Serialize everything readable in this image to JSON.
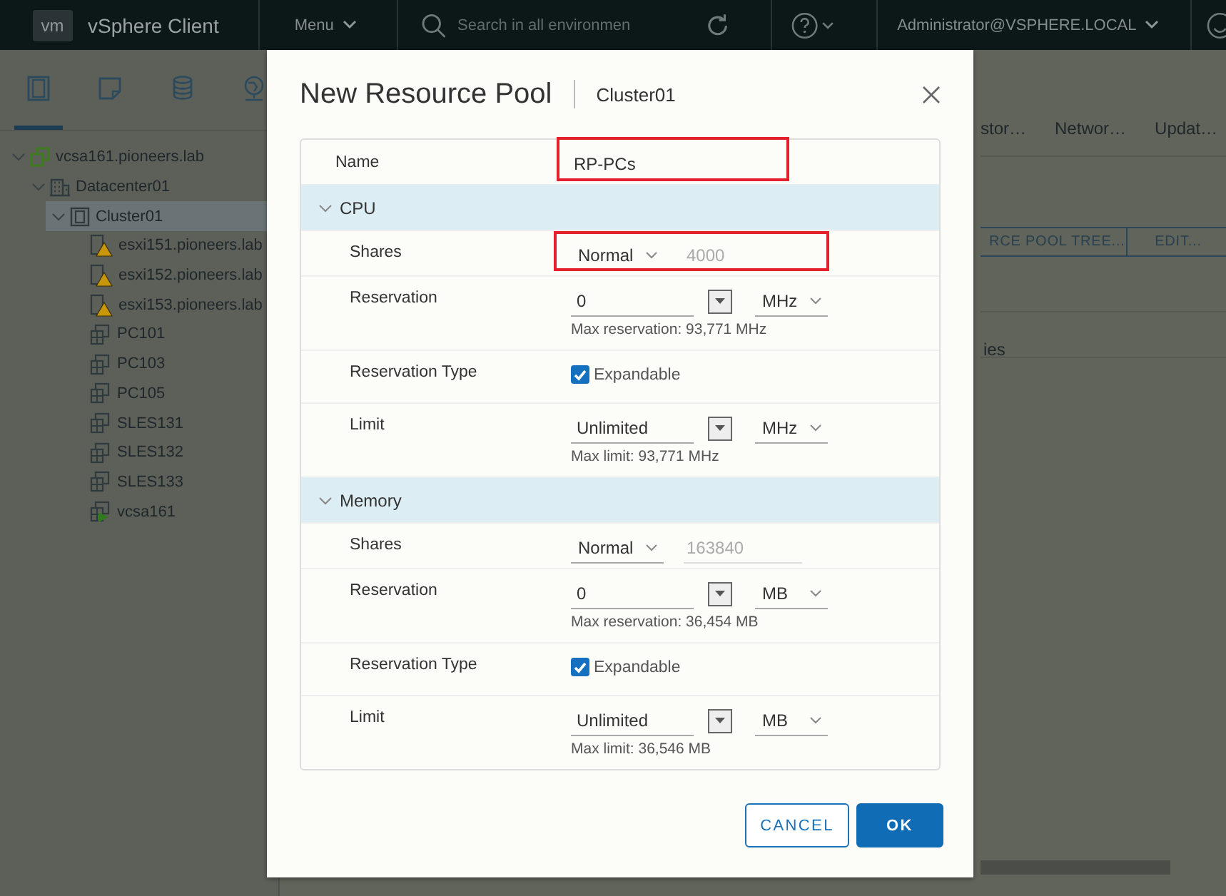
{
  "header": {
    "logo": "vm",
    "title": "vSphere Client",
    "menu": "Menu",
    "search_placeholder": "Search in all environmen",
    "user": "Administrator@VSPHERE.LOCAL"
  },
  "sidebar": {
    "tabs": [
      {
        "kind": "hosts",
        "selected": true
      },
      {
        "kind": "vms",
        "selected": false
      },
      {
        "kind": "storage",
        "selected": false
      },
      {
        "kind": "network",
        "selected": false
      }
    ],
    "tree": [
      {
        "label": "vcsa161.pioneers.lab",
        "kind": "vcenter",
        "expanded": true,
        "selected": false,
        "children": [
          {
            "label": "Datacenter01",
            "kind": "datacenter",
            "expanded": true,
            "selected": false,
            "children": [
              {
                "label": "Cluster01",
                "kind": "cluster",
                "expanded": true,
                "selected": true,
                "children": [
                  {
                    "label": "esxi151.pioneers.lab",
                    "kind": "host",
                    "warning": true,
                    "selected": false
                  },
                  {
                    "label": "esxi152.pioneers.lab",
                    "kind": "host",
                    "warning": true,
                    "selected": false
                  },
                  {
                    "label": "esxi153.pioneers.lab",
                    "kind": "host",
                    "warning": true,
                    "selected": false
                  },
                  {
                    "label": "PC101",
                    "kind": "vm",
                    "selected": false
                  },
                  {
                    "label": "PC103",
                    "kind": "vm",
                    "selected": false
                  },
                  {
                    "label": "PC105",
                    "kind": "vm",
                    "selected": false
                  },
                  {
                    "label": "SLES131",
                    "kind": "vm",
                    "selected": false
                  },
                  {
                    "label": "SLES132",
                    "kind": "vm",
                    "selected": false
                  },
                  {
                    "label": "SLES133",
                    "kind": "vm",
                    "selected": false
                  },
                  {
                    "label": "vcsa161",
                    "kind": "vm-running",
                    "selected": false
                  }
                ]
              }
            ]
          }
        ]
      }
    ]
  },
  "content": {
    "tabs": [
      "stor…",
      "Networ…",
      "Updat…"
    ],
    "buttons": [
      "RCE POOL TREE...",
      "EDIT..."
    ],
    "rows": [
      "",
      "ies"
    ]
  },
  "dialog": {
    "title": "New Resource Pool",
    "subtitle": "Cluster01",
    "name": {
      "label": "Name",
      "value": "RP-PCs",
      "highlighted": true
    },
    "sections": [
      {
        "title": "CPU",
        "expanded": true,
        "rows": [
          {
            "kind": "shares",
            "label": "Shares",
            "value": "Normal",
            "number": "4000",
            "highlighted": true
          },
          {
            "kind": "amount",
            "label": "Reservation",
            "value": "0",
            "unit": "MHz",
            "hint": "Max reservation: 93,771 MHz",
            "highlighted": false
          },
          {
            "kind": "checkbox",
            "label": "Reservation Type",
            "option": "Expandable",
            "checked": true,
            "highlighted": false
          },
          {
            "kind": "amount",
            "label": "Limit",
            "value": "Unlimited",
            "unit": "MHz",
            "hint": "Max limit: 93,771 MHz",
            "highlighted": false
          }
        ]
      },
      {
        "title": "Memory",
        "expanded": true,
        "rows": [
          {
            "kind": "shares",
            "label": "Shares",
            "value": "Normal",
            "number": "163840",
            "highlighted": false
          },
          {
            "kind": "amount",
            "label": "Reservation",
            "value": "0",
            "unit": "MB",
            "hint": "Max reservation: 36,454 MB",
            "highlighted": false
          },
          {
            "kind": "checkbox",
            "label": "Reservation Type",
            "option": "Expandable",
            "checked": true,
            "highlighted": false
          },
          {
            "kind": "amount",
            "label": "Limit",
            "value": "Unlimited",
            "unit": "MB",
            "hint": "Max limit: 36,546 MB",
            "highlighted": false
          }
        ]
      }
    ],
    "buttons": [
      {
        "label": "CANCEL",
        "kind": "secondary"
      },
      {
        "label": "OK",
        "kind": "primary"
      }
    ]
  }
}
